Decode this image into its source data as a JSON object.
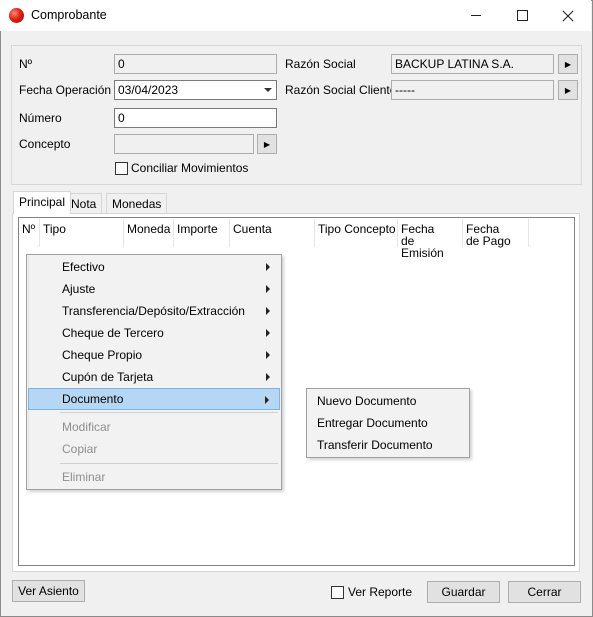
{
  "window": {
    "title": "Comprobante",
    "controls": [
      "minimize",
      "maximize",
      "close"
    ],
    "icon": "app-logo-icon"
  },
  "form": {
    "numero_id_label": "Nº",
    "numero_id_value": "0",
    "fecha_label": "Fecha Operación",
    "fecha_value": "03/04/2023",
    "numero_label": "Número",
    "numero_value": "0",
    "concepto_label": "Concepto",
    "concepto_value": "",
    "conciliar_label": "Conciliar Movimientos",
    "conciliar_checked": false,
    "razon_social_label": "Razón Social",
    "razon_social_value": "BACKUP LATINA S.A.",
    "razon_social_cliente_label": "Razón Social Cliente",
    "razon_social_cliente_value": "-----"
  },
  "tabs": [
    {
      "label": "Principal",
      "active": true
    },
    {
      "label": "Nota",
      "active": false
    },
    {
      "label": "Monedas",
      "active": false
    }
  ],
  "grid": {
    "columns": [
      "Nº",
      "Tipo",
      "Moneda",
      "Importe",
      "Cuenta",
      "Tipo Concepto",
      "Fecha\nde Emisión",
      "Fecha\nde Pago"
    ],
    "rows": []
  },
  "context_menu": {
    "items": [
      {
        "label": "Efectivo",
        "submenu": true,
        "enabled": true
      },
      {
        "label": "Ajuste",
        "submenu": true,
        "enabled": true
      },
      {
        "label": "Transferencia/Depósito/Extracción",
        "submenu": true,
        "enabled": true
      },
      {
        "label": "Cheque de Tercero",
        "submenu": true,
        "enabled": true
      },
      {
        "label": "Cheque Propio",
        "submenu": true,
        "enabled": true
      },
      {
        "label": "Cupón de Tarjeta",
        "submenu": true,
        "enabled": true
      },
      {
        "label": "Documento",
        "submenu": true,
        "enabled": true,
        "highlighted": true
      },
      {
        "label": "Modificar",
        "submenu": false,
        "enabled": false
      },
      {
        "label": "Copiar",
        "submenu": false,
        "enabled": false
      },
      {
        "label": "Eliminar",
        "submenu": false,
        "enabled": false
      }
    ],
    "submenu": {
      "items": [
        "Nuevo Documento",
        "Entregar Documento",
        "Transferir Documento"
      ]
    }
  },
  "footer": {
    "ver_asiento": "Ver Asiento",
    "ver_reporte": "Ver Reporte",
    "ver_reporte_checked": false,
    "guardar": "Guardar",
    "cerrar": "Cerrar"
  },
  "colors": {
    "window_bg": "#f0f0f0",
    "menu_highlight": "#b5d7f3",
    "disabled_text": "#8e8e8e",
    "app_icon": "#e02010"
  }
}
